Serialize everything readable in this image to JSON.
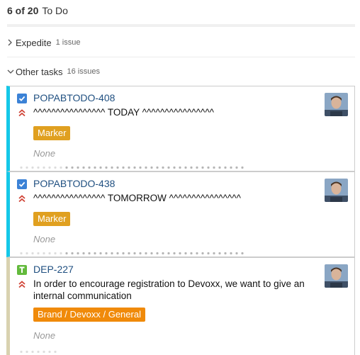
{
  "column": {
    "count": "6 of 20",
    "name": "To Do"
  },
  "swimlanes": [
    {
      "name": "Expedite",
      "count": "1 issue",
      "icon": "chevron-right-icon"
    },
    {
      "name": "Other tasks",
      "count": "16 issues",
      "icon": "chevron-down-icon"
    }
  ],
  "cards": [
    {
      "key": "POPABTODO-408",
      "type_icon": "task-checkbox-icon",
      "priority_icon": "priority-highest-icon",
      "summary": "^^^^^^^^^^^^^^^^ TODAY ^^^^^^^^^^^^^^^^",
      "label": "Marker",
      "field_value": "None",
      "accent_color": "#14c8e8"
    },
    {
      "key": "POPABTODO-438",
      "type_icon": "task-checkbox-icon",
      "priority_icon": "priority-highest-icon",
      "summary": "^^^^^^^^^^^^^^^^ TOMORROW ^^^^^^^^^^^^^^^^",
      "label": "Marker",
      "field_value": "None",
      "accent_color": "#14c8e8"
    },
    {
      "key": "DEP-227",
      "type_icon": "story-icon",
      "priority_icon": "priority-highest-icon",
      "summary": "In order to encourage registration to Devoxx, we want to give an internal communication",
      "label": "Brand / Devoxx / General",
      "field_value": "None",
      "accent_color": "#d9d2b0"
    }
  ],
  "colors": {
    "link": "#205081",
    "task_icon": "#3b82d6",
    "story_icon": "#63ba3c",
    "priority": "#d04437",
    "label_marker": "#e0a020",
    "label_brand": "#f08a0a"
  }
}
